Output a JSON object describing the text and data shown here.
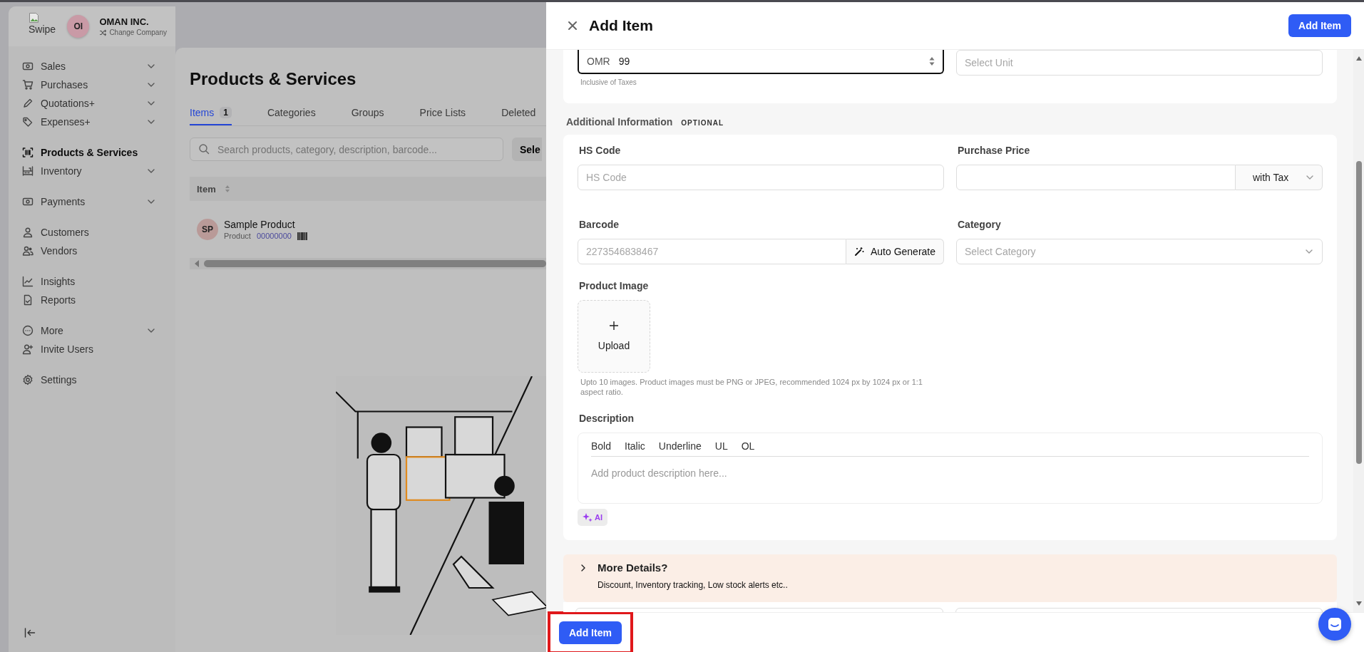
{
  "sidebar": {
    "logo_alt": "Swipe",
    "company": {
      "initials": "OI",
      "name": "OMAN INC.",
      "action": "Change Company"
    },
    "groups": [
      [
        {
          "label": "Sales",
          "expandable": true,
          "selected": false
        },
        {
          "label": "Purchases",
          "expandable": true,
          "selected": false
        },
        {
          "label": "Quotations+",
          "expandable": true,
          "selected": false
        },
        {
          "label": "Expenses+",
          "expandable": true,
          "selected": false
        }
      ],
      [
        {
          "label": "Products & Services",
          "expandable": false,
          "selected": true
        },
        {
          "label": "Inventory",
          "expandable": true,
          "selected": false
        }
      ],
      [
        {
          "label": "Payments",
          "expandable": true,
          "selected": false
        }
      ],
      [
        {
          "label": "Customers",
          "expandable": false,
          "selected": false
        },
        {
          "label": "Vendors",
          "expandable": false,
          "selected": false
        }
      ],
      [
        {
          "label": "Insights",
          "expandable": false,
          "selected": false
        },
        {
          "label": "Reports",
          "expandable": false,
          "selected": false
        }
      ],
      [
        {
          "label": "More",
          "expandable": true,
          "selected": false
        },
        {
          "label": "Invite Users",
          "expandable": false,
          "selected": false
        }
      ],
      [
        {
          "label": "Settings",
          "expandable": false,
          "selected": false
        }
      ]
    ]
  },
  "main": {
    "title": "Products & Services",
    "tabs": [
      {
        "label": "Items",
        "count": "1",
        "selected": true
      },
      {
        "label": "Categories",
        "selected": false
      },
      {
        "label": "Groups",
        "selected": false
      },
      {
        "label": "Price Lists",
        "selected": false
      },
      {
        "label": "Deleted",
        "selected": false
      }
    ],
    "search": {
      "placeholder": "Search products, category, description, barcode..."
    },
    "select_button": "Sele",
    "table": {
      "columns": [
        "Item"
      ],
      "rows": [
        {
          "initials": "SP",
          "name": "Sample Product",
          "type": "Product",
          "code": "00000000"
        }
      ]
    }
  },
  "drawer": {
    "title": "Add Item",
    "primary_button": "Add Item",
    "price": {
      "currency": "OMR",
      "value": "99",
      "focused": true,
      "hint": "Inclusive of Taxes"
    },
    "unit": {
      "placeholder": "Select Unit"
    },
    "additional": {
      "heading": "Additional Information",
      "tag": "OPTIONAL",
      "hs_code": {
        "label": "HS Code",
        "placeholder": "HS Code"
      },
      "purchase_price": {
        "label": "Purchase Price",
        "tax_option": "with Tax"
      },
      "barcode": {
        "label": "Barcode",
        "placeholder": "2273546838467",
        "button": "Auto Generate"
      },
      "category": {
        "label": "Category",
        "placeholder": "Select Category"
      },
      "image": {
        "label": "Product Image",
        "button": "Upload",
        "hint": "Upto 10 images. Product images must be PNG or JPEG, recommended 1024 px by 1024 px or 1:1 aspect ratio."
      },
      "description": {
        "label": "Description",
        "toolbar": [
          "Bold",
          "Italic",
          "Underline",
          "UL",
          "OL"
        ],
        "placeholder": "Add product description here...",
        "ai_button": "AI"
      }
    },
    "more_details": {
      "title": "More Details?",
      "text": "Discount, Inventory tracking, Low stock alerts etc..",
      "expanded": false
    },
    "footer": {
      "button": "Add Item",
      "highlighted": true
    }
  }
}
